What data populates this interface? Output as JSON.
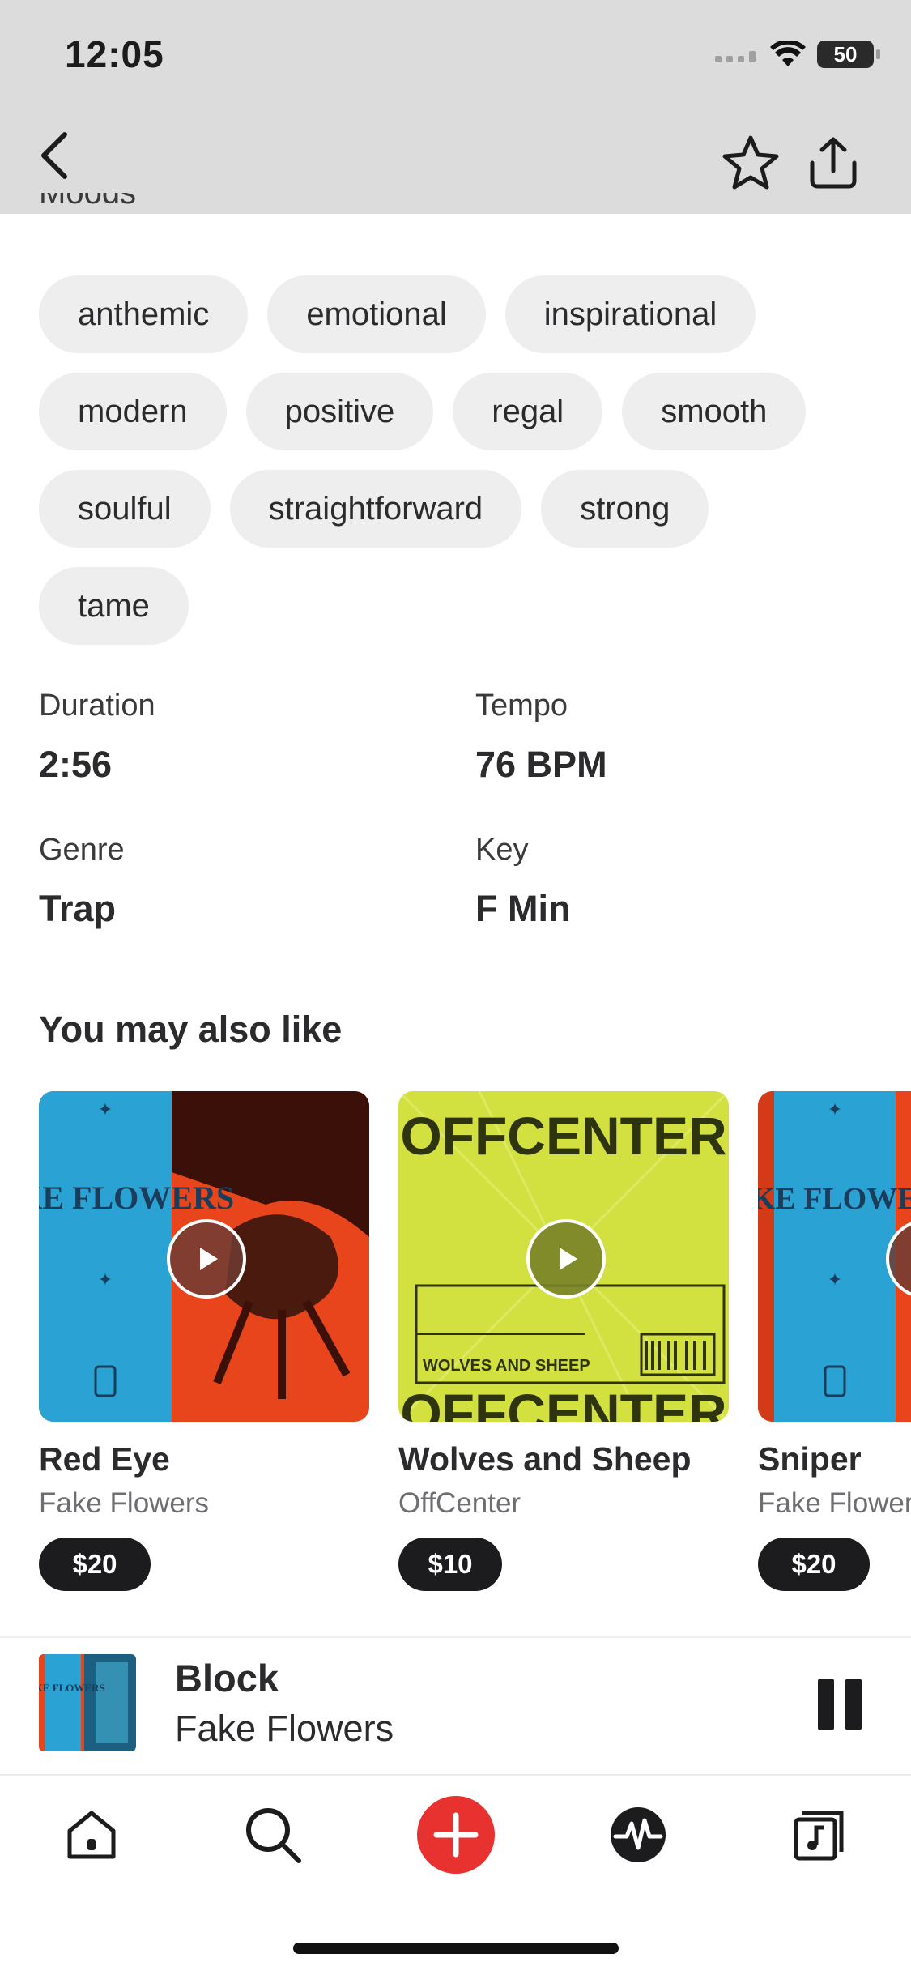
{
  "status_bar": {
    "time": "12:05",
    "battery": "50"
  },
  "header": {
    "back_icon": "chevron-left-icon",
    "favorite_icon": "star-outline-icon",
    "share_icon": "share-icon"
  },
  "moods_section": {
    "title": "Moods",
    "tags": [
      "anthemic",
      "emotional",
      "inspirational",
      "modern",
      "positive",
      "regal",
      "smooth",
      "soulful",
      "straightforward",
      "strong",
      "tame"
    ]
  },
  "details": {
    "duration_label": "Duration",
    "duration_value": "2:56",
    "tempo_label": "Tempo",
    "tempo_value": "76 BPM",
    "genre_label": "Genre",
    "genre_value": "Trap",
    "key_label": "Key",
    "key_value": "F Min"
  },
  "recommendations": {
    "title": "You may also like",
    "items": [
      {
        "title": "Red Eye",
        "artist": "Fake Flowers",
        "price": "$20",
        "cover_text": "FAKE FLOWERS"
      },
      {
        "title": "Wolves and Sheep",
        "artist": "OffCenter",
        "price": "$10",
        "cover_text": "OFFCENTER",
        "cover_subtext": "WOLVES AND SHEEP"
      },
      {
        "title": "Sniper",
        "artist": "Fake Flowers",
        "price": "$20",
        "cover_text": "FAKE FLOWERS"
      }
    ]
  },
  "now_playing": {
    "title": "Block",
    "artist": "Fake Flowers",
    "cover_text": "FAKE FLOWERS"
  },
  "bottom_nav": {
    "items": [
      "home-icon",
      "search-icon",
      "add-icon",
      "activity-icon",
      "library-icon"
    ],
    "accent_color": "#e8322f"
  },
  "colors": {
    "header_bg": "#dcdcdc",
    "tag_bg": "#eeeeef",
    "price_bg": "#1c1c1e"
  }
}
